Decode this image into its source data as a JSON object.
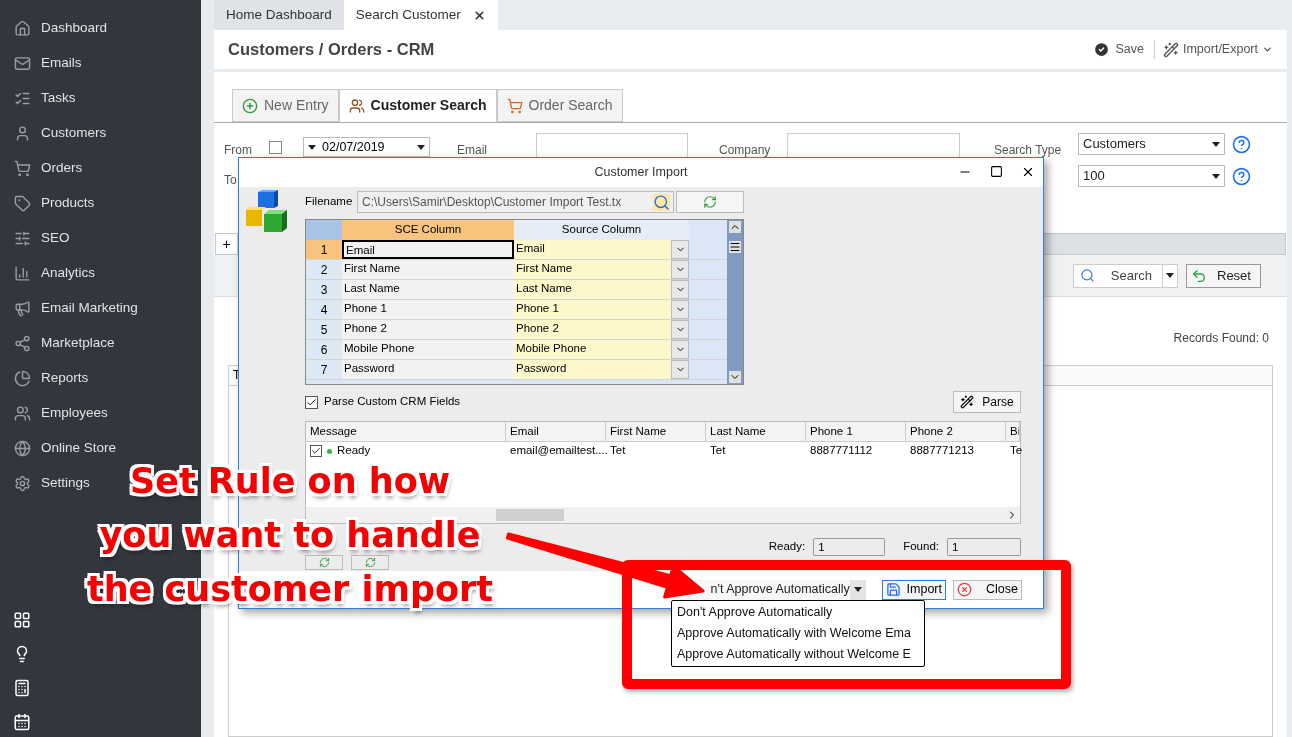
{
  "sidebar": {
    "items": [
      {
        "label": "Dashboard"
      },
      {
        "label": "Emails"
      },
      {
        "label": "Tasks"
      },
      {
        "label": "Customers"
      },
      {
        "label": "Orders"
      },
      {
        "label": "Products"
      },
      {
        "label": "SEO"
      },
      {
        "label": "Analytics"
      },
      {
        "label": "Email Marketing"
      },
      {
        "label": "Marketplace"
      },
      {
        "label": "Reports"
      },
      {
        "label": "Employees"
      },
      {
        "label": "Online Store"
      },
      {
        "label": "Settings"
      }
    ]
  },
  "doc_tabs": [
    {
      "label": "Home Dashboard",
      "selected": false,
      "closable": false
    },
    {
      "label": "Search Customer",
      "selected": true,
      "closable": true
    }
  ],
  "page": {
    "title": "Customers / Orders - CRM",
    "save": "Save",
    "import_export": "Import/Export"
  },
  "mode_tabs": [
    {
      "label": "New Entry",
      "selected": false
    },
    {
      "label": "Customer Search",
      "selected": true
    },
    {
      "label": "Order Search",
      "selected": false
    }
  ],
  "filters": {
    "from_label": "From",
    "from_checked": false,
    "from_date": "02/07/2019",
    "to_label": "To",
    "email_label": "Email",
    "company_label": "Company",
    "search_type_label": "Search Type",
    "search_type": "Customers",
    "row_limit": "100"
  },
  "add_button": "+",
  "toolbar": {
    "search": "Search",
    "reset": "Reset"
  },
  "records_found": "Records Found: 0",
  "results_grid": {
    "column_1": "T"
  },
  "dialog": {
    "title": "Customer Import",
    "filename_label": "Filename",
    "filename": "C:\\Users\\Samir\\Desktop\\Customer Import Test.tx",
    "mapping": {
      "columns": [
        "SCE Column",
        "Source Column"
      ],
      "rows": [
        {
          "num": "1",
          "sce": "Email",
          "source": "Email",
          "selected": true
        },
        {
          "num": "2",
          "sce": "First Name",
          "source": "First Name",
          "selected": false
        },
        {
          "num": "3",
          "sce": "Last Name",
          "source": "Last Name",
          "selected": false
        },
        {
          "num": "4",
          "sce": "Phone 1",
          "source": "Phone 1",
          "selected": false
        },
        {
          "num": "5",
          "sce": "Phone 2",
          "source": "Phone 2",
          "selected": false
        },
        {
          "num": "6",
          "sce": "Mobile Phone",
          "source": "Mobile Phone",
          "selected": false
        },
        {
          "num": "7",
          "sce": "Password",
          "source": "Password",
          "selected": false
        }
      ]
    },
    "parse_custom": {
      "label": "Parse Custom CRM Fields",
      "checked": true
    },
    "parse_button": "Parse",
    "preview": {
      "columns": [
        "Message",
        "Email",
        "First Name",
        "Last Name",
        "Phone 1",
        "Phone 2",
        "Bi"
      ],
      "rows": [
        {
          "checked": true,
          "cells": [
            "Ready",
            "email@emailtest....",
            "Tet",
            "Tet",
            "8887771112",
            "8887771213",
            "Te"
          ]
        }
      ]
    },
    "ready_label": "Ready:",
    "ready": "1",
    "found_label": "Found:",
    "found": "1",
    "approve_select": "n't Approve Automatically",
    "approve_options": [
      "Don't Approve Automatically",
      "Approve Automatically with Welcome Ema",
      "Approve Automatically without Welcome E"
    ],
    "import_button": "Import",
    "close_button": "Close"
  },
  "annotation": {
    "lines": [
      "Set Rule on how",
      "you want to handle",
      "the customer import"
    ]
  }
}
